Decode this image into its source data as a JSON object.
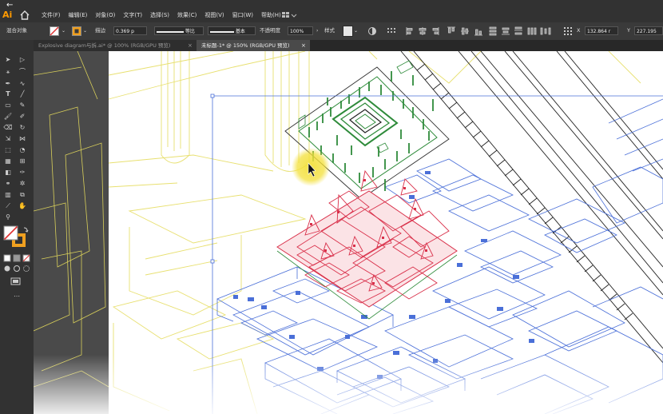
{
  "app": {
    "logo_text": "Ai"
  },
  "menu": [
    "文件(F)",
    "编辑(E)",
    "对象(O)",
    "文字(T)",
    "选择(S)",
    "效果(C)",
    "视图(V)",
    "窗口(W)",
    "帮助(H)"
  ],
  "control_bar": {
    "selection_label": "混合对象",
    "stroke_label": "描边",
    "stroke_value": "0.369 p",
    "profile_label": "等比",
    "brush_label": "基本",
    "opacity_label": "不透明度",
    "opacity_value": "100%",
    "style_label": "样式",
    "x_label": "X",
    "x_value": "132.864 r",
    "y_label": "Y",
    "y_value": "227.195"
  },
  "tabs": [
    {
      "label": "Explosive diagram与拆.ai* @ 100% (RGB/GPU 预览)",
      "active": false,
      "close": "×"
    },
    {
      "label": "未标题-1* @ 150% (RGB/GPU 预览)",
      "active": true,
      "close": "×"
    }
  ],
  "icons": {
    "back": "arrow-left-icon",
    "home": "home-icon",
    "cursor": "pointer-cursor-icon"
  },
  "colors": {
    "illustrator_orange": "#ff9a00",
    "fill_swatch_stroke": "#e03030",
    "stroke_swatch": "#f0a020",
    "yellow_lines": "#e8e070",
    "green_art": "#2e8b3a",
    "red_art": "#d9304a",
    "blue_art": "#4a6fd8",
    "cursor_highlight": "#f3e03a"
  }
}
